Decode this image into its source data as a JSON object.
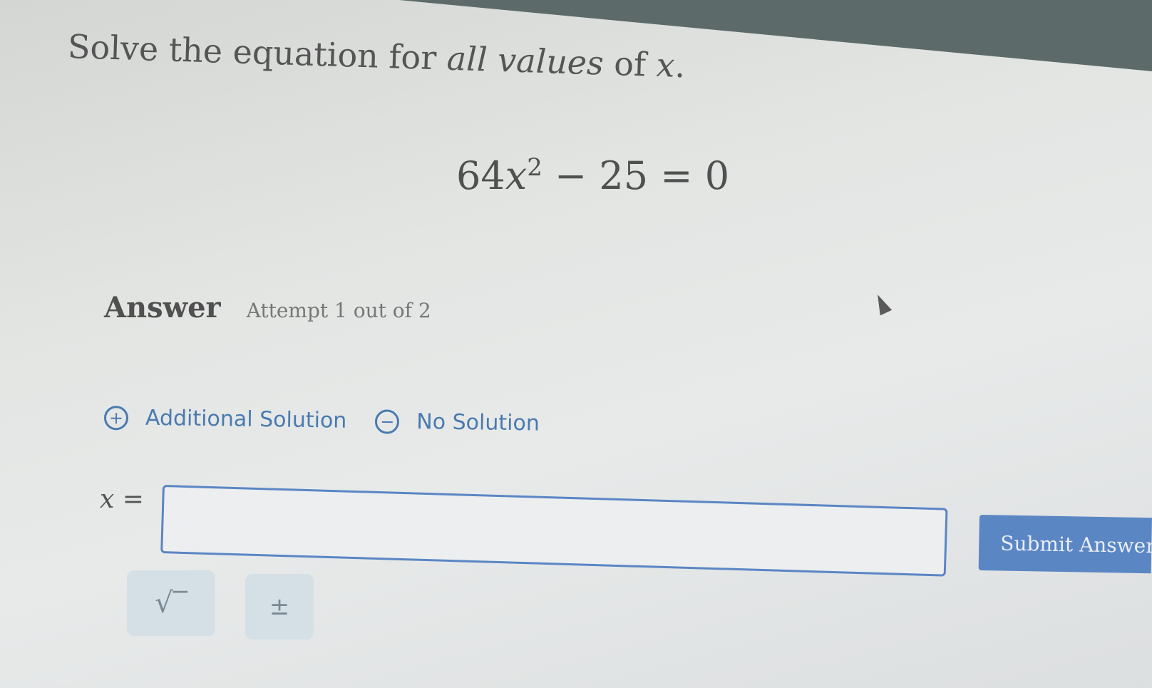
{
  "question": {
    "prefix": "Solve the equation for ",
    "emphasis": "all values",
    "suffix": " of ",
    "variable": "x",
    "end": "."
  },
  "equation": {
    "coefficient": "64",
    "variable": "x",
    "exponent": "2",
    "rest": " − 25 = 0"
  },
  "answer": {
    "heading": "Answer",
    "attempt": "Attempt 1 out of 2"
  },
  "options": {
    "additional_icon": "+",
    "additional_label": "Additional Solution",
    "no_solution_icon": "−",
    "no_solution_label": "No Solution"
  },
  "input": {
    "label": "x =",
    "value": ""
  },
  "submit": {
    "label": "Submit Answer"
  },
  "tools": {
    "sqrt": "√‾",
    "plus_minus": "±"
  },
  "colors": {
    "accent": "#5b86c4",
    "link": "#4a7ab0",
    "tool_bg": "#d5e0e6"
  }
}
